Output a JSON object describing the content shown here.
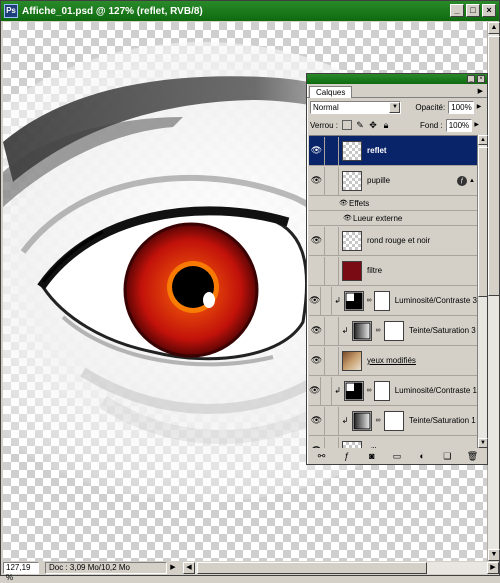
{
  "document": {
    "title": "Affiche_01.psd @ 127% (reflet, RVB/8)",
    "status": {
      "zoom": "127,19 %",
      "doc_size": "Doc : 3,09 Mo/10,2 Mo"
    }
  },
  "window_buttons": {
    "minimize": "_",
    "maximize": "□",
    "close": "×"
  },
  "layers_panel": {
    "tab": "Calques",
    "blend_mode": "Normal",
    "opacity_label": "Opacité:",
    "opacity_value": "100%",
    "lock_label": "Verrou :",
    "fill_label": "Fond :",
    "fill_value": "100%",
    "layers": [
      {
        "name": "reflet",
        "selected": true,
        "visible": true,
        "thumb": "transparent"
      },
      {
        "name": "pupille",
        "visible": true,
        "thumb": "transparent",
        "has_effects": true,
        "effects_label": "Effets",
        "effects": [
          "Lueur externe"
        ]
      },
      {
        "name": "rond rouge et noir",
        "visible": true,
        "thumb": "transparent"
      },
      {
        "name": "filtre",
        "visible": false,
        "thumb": "dark-red"
      },
      {
        "name": "Luminosité/Contraste 3",
        "visible": true,
        "thumb": "adjust-bc",
        "clipped": true
      },
      {
        "name": "Teinte/Saturation 3",
        "visible": true,
        "thumb": "adjust-hs",
        "clipped": true
      },
      {
        "name": "yeux modifiés",
        "visible": true,
        "thumb": "photo",
        "underlined": true
      },
      {
        "name": "Luminosité/Contraste 1",
        "visible": true,
        "thumb": "adjust-bc",
        "clipped": true
      },
      {
        "name": "Teinte/Saturation 1",
        "visible": true,
        "thumb": "adjust-hs",
        "clipped": true
      },
      {
        "name": "ville",
        "visible": true,
        "thumb": "transparent",
        "underlined": true
      }
    ]
  },
  "colors": {
    "titlebar": "#0f6a0f",
    "selection": "#0a246a",
    "iris": "#c2120a"
  }
}
